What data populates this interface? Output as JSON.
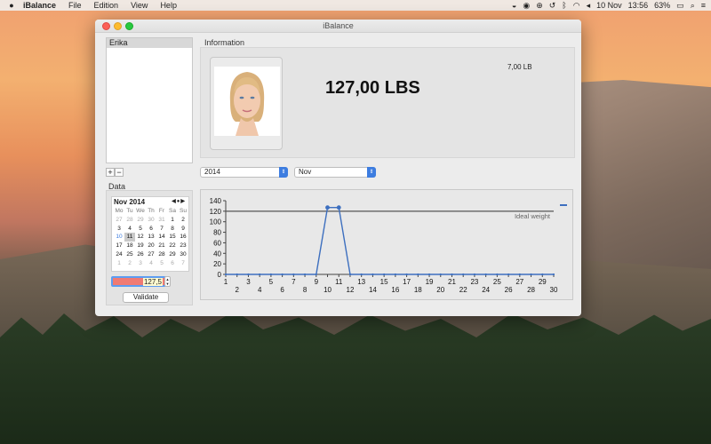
{
  "menubar": {
    "app_name": "iBalance",
    "items": [
      "File",
      "Edition",
      "View",
      "Help"
    ],
    "status": {
      "battery": "63%",
      "date": "10 Nov",
      "time": "13:56"
    },
    "status_icons": [
      "spy-icon",
      "eye-icon",
      "globe-icon",
      "timemachine-icon",
      "bluetooth-icon",
      "wifi-icon",
      "volume-icon",
      "battery-icon",
      "search-icon",
      "list-icon"
    ]
  },
  "window": {
    "title": "iBalance",
    "users": [
      "Erika"
    ],
    "information_label": "Information",
    "data_label": "Data",
    "current_weight": "127,00 LBS",
    "difference": "7,00 LB",
    "year_select": "2014",
    "month_select": "Nov",
    "weight_input": "127,5",
    "validate_label": "Validate",
    "plus_label": "+",
    "minus_label": "−"
  },
  "calendar": {
    "month_label": "Nov 2014",
    "day_headers": [
      "Mo",
      "Tu",
      "We",
      "Th",
      "Fr",
      "Sa",
      "Su"
    ],
    "weeks": [
      [
        {
          "d": "27",
          "dim": true
        },
        {
          "d": "28",
          "dim": true
        },
        {
          "d": "29",
          "dim": true
        },
        {
          "d": "30",
          "dim": true
        },
        {
          "d": "31",
          "dim": true
        },
        {
          "d": "1"
        },
        {
          "d": "2"
        }
      ],
      [
        {
          "d": "3"
        },
        {
          "d": "4"
        },
        {
          "d": "5"
        },
        {
          "d": "6"
        },
        {
          "d": "7"
        },
        {
          "d": "8"
        },
        {
          "d": "9"
        }
      ],
      [
        {
          "d": "10",
          "today": true
        },
        {
          "d": "11",
          "sel": true
        },
        {
          "d": "12"
        },
        {
          "d": "13"
        },
        {
          "d": "14"
        },
        {
          "d": "15"
        },
        {
          "d": "16"
        }
      ],
      [
        {
          "d": "17"
        },
        {
          "d": "18"
        },
        {
          "d": "19"
        },
        {
          "d": "20"
        },
        {
          "d": "21"
        },
        {
          "d": "22"
        },
        {
          "d": "23"
        }
      ],
      [
        {
          "d": "24"
        },
        {
          "d": "25"
        },
        {
          "d": "26"
        },
        {
          "d": "27"
        },
        {
          "d": "28"
        },
        {
          "d": "29"
        },
        {
          "d": "30"
        }
      ],
      [
        {
          "d": "1",
          "dim": true
        },
        {
          "d": "2",
          "dim": true
        },
        {
          "d": "3",
          "dim": true
        },
        {
          "d": "4",
          "dim": true
        },
        {
          "d": "5",
          "dim": true
        },
        {
          "d": "6",
          "dim": true
        },
        {
          "d": "7",
          "dim": true
        }
      ]
    ]
  },
  "chart_data": {
    "type": "line",
    "x": [
      1,
      2,
      3,
      4,
      5,
      6,
      7,
      8,
      9,
      10,
      11,
      12,
      13,
      14,
      15,
      16,
      17,
      18,
      19,
      20,
      21,
      22,
      23,
      24,
      25,
      26,
      27,
      28,
      29,
      30
    ],
    "series": [
      {
        "values": [
          0,
          0,
          0,
          0,
          0,
          0,
          0,
          0,
          0,
          127,
          127,
          0,
          0,
          0,
          0,
          0,
          0,
          0,
          0,
          0,
          0,
          0,
          0,
          0,
          0,
          0,
          0,
          0,
          0,
          0
        ]
      }
    ],
    "reference_line": {
      "label": "Ideal weight",
      "value": 120
    },
    "ylim": [
      0,
      140
    ],
    "yticks": [
      0,
      20,
      40,
      60,
      80,
      100,
      120,
      140
    ],
    "xlim": [
      1,
      30
    ],
    "color": "#3d6fbf",
    "reference_color": "#555555"
  }
}
